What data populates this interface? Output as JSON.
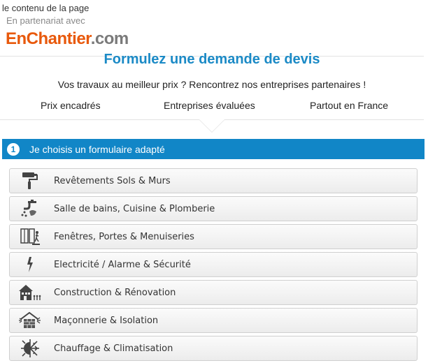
{
  "header": {
    "top_line": "le contenu de la page",
    "partner_line": "En partenariat avec",
    "logo_part1": "EnChantier",
    "logo_part2": ".com"
  },
  "main": {
    "title": "Formulez une demande de devis",
    "subtitle": "Vos travaux au meilleur prix ? Rencontrez nos entreprises partenaires !",
    "features": [
      "Prix encadrés",
      "Entreprises évaluées",
      "Partout en France"
    ]
  },
  "step": {
    "number": "1",
    "label": "Je choisis un formulaire adapté"
  },
  "categories": [
    {
      "label": "Revêtements Sols & Murs",
      "icon": "paint-roller-icon"
    },
    {
      "label": "Salle de bains, Cuisine & Plomberie",
      "icon": "faucet-icon"
    },
    {
      "label": "Fenêtres, Portes & Menuiseries",
      "icon": "door-window-icon"
    },
    {
      "label": "Electricité / Alarme & Sécurité",
      "icon": "lightning-icon"
    },
    {
      "label": "Construction & Rénovation",
      "icon": "house-construction-icon"
    },
    {
      "label": "Maçonnerie & Isolation",
      "icon": "brick-wall-icon"
    },
    {
      "label": "Chauffage & Climatisation",
      "icon": "sun-snowflake-icon"
    }
  ],
  "colors": {
    "brand_orange": "#e8590c",
    "title_blue": "#1b8ac6",
    "step_bar_blue": "#1186c7",
    "icon_gray": "#444444"
  }
}
